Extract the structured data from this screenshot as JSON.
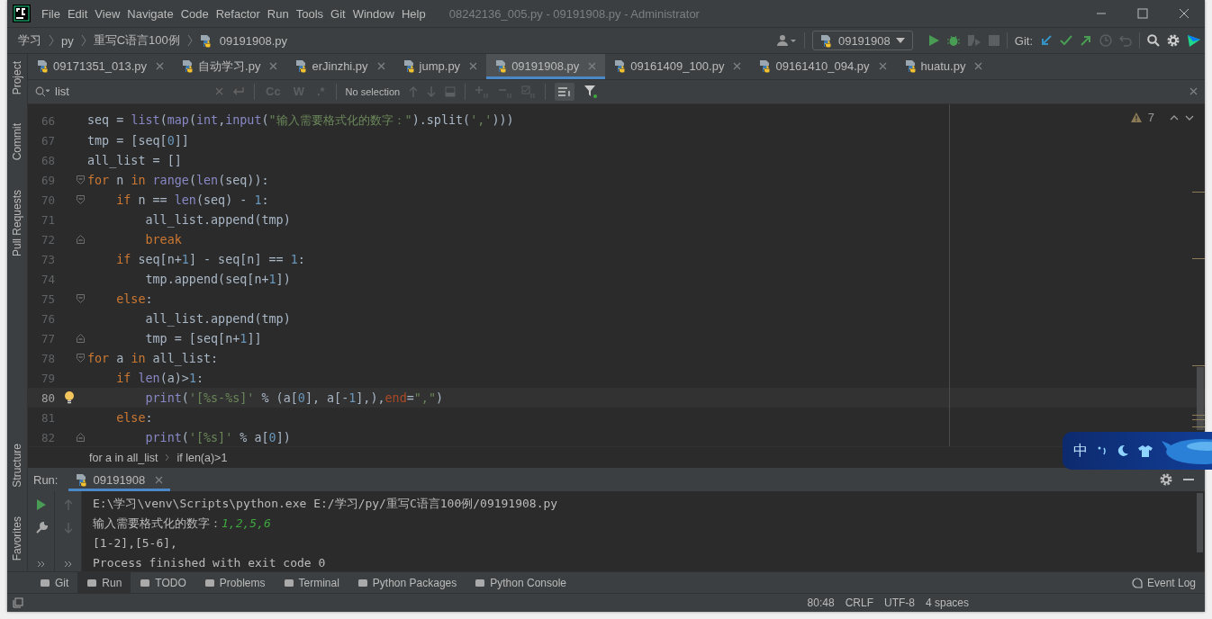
{
  "window": {
    "title": "08242136_005.py - 09191908.py - Administrator"
  },
  "menu": [
    "File",
    "Edit",
    "View",
    "Navigate",
    "Code",
    "Refactor",
    "Run",
    "Tools",
    "Git",
    "Window",
    "Help"
  ],
  "navbar": {
    "breadcrumbs": [
      "学习",
      "py",
      "重写C语言100例",
      "09191908.py"
    ],
    "run_config": "09191908",
    "git_label": "Git:"
  },
  "tool_stripe": {
    "top": [
      "Project",
      "Commit",
      "Pull Requests"
    ],
    "bottom": [
      "Structure",
      "Favorites"
    ]
  },
  "tabs": [
    {
      "label": "09171351_013.py",
      "selected": false
    },
    {
      "label": "自动学习.py",
      "selected": false
    },
    {
      "label": "erJinzhi.py",
      "selected": false
    },
    {
      "label": "jump.py",
      "selected": false
    },
    {
      "label": "09191908.py",
      "selected": true
    },
    {
      "label": "09161409_100.py",
      "selected": false
    },
    {
      "label": "09161410_094.py",
      "selected": false
    },
    {
      "label": "huatu.py",
      "selected": false
    }
  ],
  "find_bar": {
    "value": "list",
    "options": [
      "Cc",
      "W",
      ".*"
    ],
    "status": "No selection"
  },
  "editor": {
    "problems": "7",
    "lines": [
      {
        "no": "66",
        "kind": "plain",
        "current": false,
        "code": [
          {
            "kind": "p",
            "text": "seq = "
          },
          {
            "kind": "b",
            "text": "list"
          },
          {
            "kind": "p",
            "text": "("
          },
          {
            "kind": "b",
            "text": "map"
          },
          {
            "kind": "p",
            "text": "("
          },
          {
            "kind": "b",
            "text": "int"
          },
          {
            "kind": "p",
            "text": ","
          },
          {
            "kind": "b",
            "text": "input"
          },
          {
            "kind": "p",
            "text": "("
          },
          {
            "kind": "s",
            "text": "\"输入需要格式化的数字：\""
          },
          {
            "kind": "p",
            "text": ").split("
          },
          {
            "kind": "s",
            "text": "','"
          },
          {
            "kind": "p",
            "text": ")))"
          }
        ]
      },
      {
        "no": "67",
        "kind": "plain",
        "current": false,
        "code": [
          {
            "kind": "p",
            "text": "tmp = [seq["
          },
          {
            "kind": "n",
            "text": "0"
          },
          {
            "kind": "p",
            "text": "]]"
          }
        ]
      },
      {
        "no": "68",
        "kind": "plain",
        "current": false,
        "code": [
          {
            "kind": "p",
            "text": "all_list = []"
          }
        ]
      },
      {
        "no": "69",
        "kind": "fold_start",
        "current": false,
        "code": [
          {
            "kind": "k",
            "text": "for"
          },
          {
            "kind": "p",
            "text": " n "
          },
          {
            "kind": "k",
            "text": "in"
          },
          {
            "kind": "b",
            "text": " range"
          },
          {
            "kind": "p",
            "text": "("
          },
          {
            "kind": "b",
            "text": "len"
          },
          {
            "kind": "p",
            "text": "(seq)):"
          }
        ]
      },
      {
        "no": "70",
        "kind": "fold_start",
        "current": false,
        "code": [
          {
            "kind": "k",
            "text": "    if"
          },
          {
            "kind": "p",
            "text": " n == "
          },
          {
            "kind": "b",
            "text": "len"
          },
          {
            "kind": "p",
            "text": "(seq) - "
          },
          {
            "kind": "n",
            "text": "1"
          },
          {
            "kind": "p",
            "text": ":"
          }
        ]
      },
      {
        "no": "71",
        "kind": "plain",
        "current": false,
        "code": [
          {
            "kind": "p",
            "text": "        all_list.append(tmp)"
          }
        ]
      },
      {
        "no": "72",
        "kind": "fold_end",
        "current": false,
        "code": [
          {
            "kind": "k",
            "text": "        break"
          }
        ]
      },
      {
        "no": "73",
        "kind": "plain",
        "current": false,
        "code": [
          {
            "kind": "k",
            "text": "    if"
          },
          {
            "kind": "p",
            "text": " seq[n+"
          },
          {
            "kind": "n",
            "text": "1"
          },
          {
            "kind": "p",
            "text": "] - seq[n] == "
          },
          {
            "kind": "n",
            "text": "1"
          },
          {
            "kind": "p",
            "text": ":"
          }
        ]
      },
      {
        "no": "74",
        "kind": "plain",
        "current": false,
        "code": [
          {
            "kind": "p",
            "text": "        tmp.append(seq[n+"
          },
          {
            "kind": "n",
            "text": "1"
          },
          {
            "kind": "p",
            "text": "])"
          }
        ]
      },
      {
        "no": "75",
        "kind": "fold_start",
        "current": false,
        "code": [
          {
            "kind": "k",
            "text": "    else"
          },
          {
            "kind": "p",
            "text": ":"
          }
        ]
      },
      {
        "no": "76",
        "kind": "plain",
        "current": false,
        "code": [
          {
            "kind": "p",
            "text": "        all_list.append(tmp)"
          }
        ]
      },
      {
        "no": "77",
        "kind": "fold_end",
        "current": false,
        "code": [
          {
            "kind": "p",
            "text": "        tmp = [seq[n+"
          },
          {
            "kind": "n",
            "text": "1"
          },
          {
            "kind": "p",
            "text": "]]"
          }
        ]
      },
      {
        "no": "78",
        "kind": "fold_start",
        "current": false,
        "code": [
          {
            "kind": "k",
            "text": "for"
          },
          {
            "kind": "p",
            "text": " a "
          },
          {
            "kind": "k",
            "text": "in"
          },
          {
            "kind": "p",
            "text": " all_list:"
          }
        ]
      },
      {
        "no": "79",
        "kind": "plain",
        "current": false,
        "code": [
          {
            "kind": "k",
            "text": "    if"
          },
          {
            "kind": "b",
            "text": " len"
          },
          {
            "kind": "p",
            "text": "(a)>"
          },
          {
            "kind": "n",
            "text": "1"
          },
          {
            "kind": "p",
            "text": ":"
          }
        ]
      },
      {
        "no": "80",
        "kind": "plain",
        "current": true,
        "bulb": true,
        "code": [
          {
            "kind": "b",
            "text": "        print"
          },
          {
            "kind": "p",
            "text": "("
          },
          {
            "kind": "s",
            "text": "'[%s-%s]'"
          },
          {
            "kind": "p",
            "text": " % (a["
          },
          {
            "kind": "n",
            "text": "0"
          },
          {
            "kind": "p",
            "text": "], a[-"
          },
          {
            "kind": "n",
            "text": "1"
          },
          {
            "kind": "p",
            "text": "],),"
          },
          {
            "kind": "a",
            "text": "end"
          },
          {
            "kind": "p",
            "text": "="
          },
          {
            "kind": "s",
            "text": "\",\""
          },
          {
            "kind": "p",
            "text": ")"
          }
        ]
      },
      {
        "no": "81",
        "kind": "plain",
        "current": false,
        "code": [
          {
            "kind": "k",
            "text": "    else"
          },
          {
            "kind": "p",
            "text": ":"
          }
        ]
      },
      {
        "no": "82",
        "kind": "fold_end",
        "current": false,
        "code": [
          {
            "kind": "b",
            "text": "        print"
          },
          {
            "kind": "p",
            "text": "("
          },
          {
            "kind": "s",
            "text": "'[%s]'"
          },
          {
            "kind": "p",
            "text": " % a["
          },
          {
            "kind": "n",
            "text": "0"
          },
          {
            "kind": "p",
            "text": "])"
          }
        ]
      }
    ]
  },
  "editor_breadcrumbs": [
    "for a in all_list",
    "if len(a)>1"
  ],
  "run_panel": {
    "label": "Run:",
    "tab": "09191908",
    "output": [
      [
        {
          "kind": "p",
          "text": "E:\\学习\\venv\\Scripts\\python.exe E:/学习/py/重写C语言100例/09191908.py"
        }
      ],
      [
        {
          "kind": "p",
          "text": "输入需要格式化的数字："
        },
        {
          "kind": "in",
          "text": "1,2,5,6"
        }
      ],
      [
        {
          "kind": "p",
          "text": "[1-2],[5-6],"
        }
      ],
      [
        {
          "kind": "p",
          "text": "Process finished with exit code 0"
        }
      ]
    ]
  },
  "tool_windows": [
    {
      "label": "Git",
      "selected": false
    },
    {
      "label": "Run",
      "selected": true
    },
    {
      "label": "TODO",
      "selected": false
    },
    {
      "label": "Problems",
      "selected": false
    },
    {
      "label": "Terminal",
      "selected": false
    },
    {
      "label": "Python Packages",
      "selected": false
    },
    {
      "label": "Python Console",
      "selected": false
    }
  ],
  "event_log": "Event Log",
  "status_bar": [
    "80:48",
    "CRLF",
    "UTF-8",
    "4 spaces"
  ],
  "ime_toolbar": {
    "label": "中"
  }
}
